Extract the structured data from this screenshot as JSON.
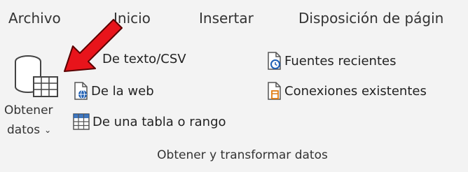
{
  "tabs": [
    {
      "label": "Archivo"
    },
    {
      "label": "Inicio"
    },
    {
      "label": "Insertar"
    },
    {
      "label": "Disposición de págin"
    }
  ],
  "get_data": {
    "line1": "Obtener",
    "line2": "datos",
    "icon": "database-table-icon",
    "dropdown_icon": "chevron-down-icon"
  },
  "commands": {
    "from_text_csv": {
      "label": "De texto/CSV",
      "icon": "text-file-icon"
    },
    "from_web": {
      "label": "De la web",
      "icon": "web-page-icon"
    },
    "from_table": {
      "label": "De una tabla o rango",
      "icon": "table-range-icon"
    },
    "recent_sources": {
      "label": "Fuentes recientes",
      "icon": "recent-sources-icon"
    },
    "existing_connections": {
      "label": "Conexiones existentes",
      "icon": "existing-connections-icon"
    }
  },
  "group": {
    "label": "Obtener y transformar datos"
  },
  "annotation": {
    "icon": "red-arrow-icon",
    "color": "#e8141b"
  },
  "colors": {
    "ribbon_bg": "#f3f3f3",
    "accent_blue": "#1e5fb4",
    "accent_orange": "#e07a10"
  }
}
